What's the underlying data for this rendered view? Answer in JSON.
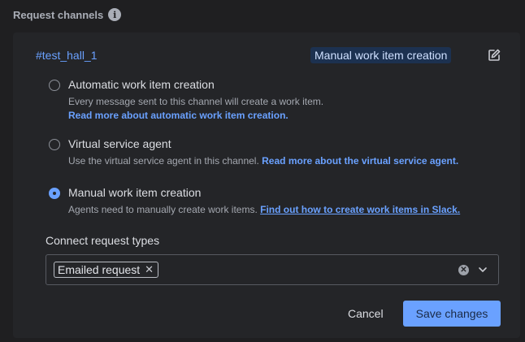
{
  "section": {
    "title": "Request channels",
    "info_icon": "info-icon"
  },
  "channel": {
    "name": "#test_hall_1",
    "current_mode": "Manual work item creation",
    "edit_icon": "edit-icon"
  },
  "options": [
    {
      "label": "Automatic work item creation",
      "description": "Every message sent to this channel will create a work item.",
      "link": "Read more about automatic work item creation.",
      "selected": false
    },
    {
      "label": "Virtual service agent",
      "description": "Use the virtual service agent in this channel.",
      "link": "Read more about the virtual service agent.",
      "selected": false
    },
    {
      "label": "Manual work item creation",
      "description": "Agents need to manually create work items.",
      "link": "Find out how to create work items in Slack.",
      "selected": true
    }
  ],
  "request_types": {
    "label": "Connect request types",
    "tags": [
      "Emailed request"
    ],
    "remove_icon": "close-icon",
    "clear_icon": "clear-icon",
    "dropdown_icon": "chevron-down-icon"
  },
  "actions": {
    "cancel": "Cancel",
    "save": "Save changes"
  },
  "colors": {
    "accent": "#6aa1ff",
    "background": "#1f1f21",
    "card": "#242528",
    "badge": "#1c3150"
  }
}
